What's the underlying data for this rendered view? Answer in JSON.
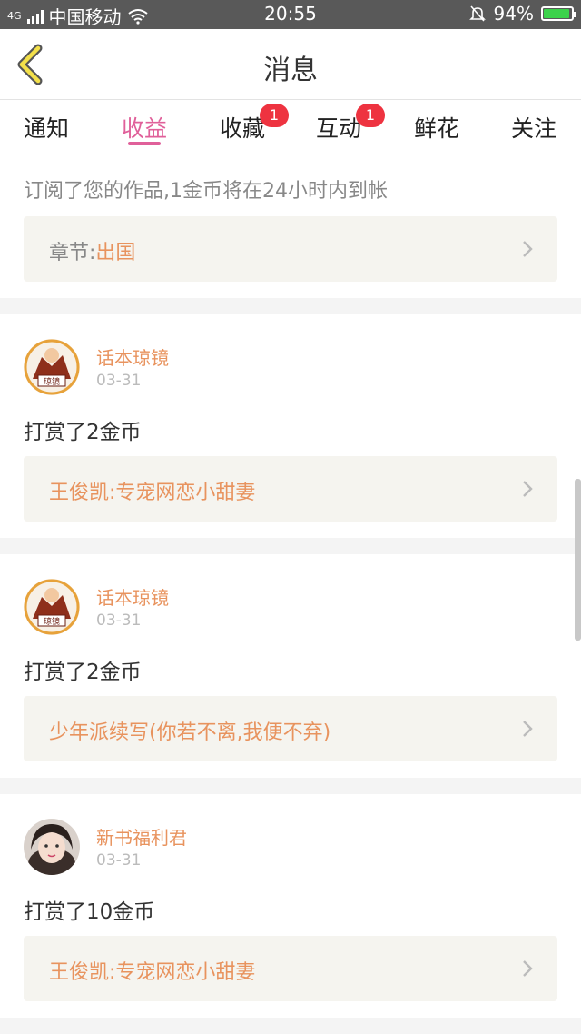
{
  "status_bar": {
    "network": "4G",
    "carrier": "中国移动",
    "time": "20:55",
    "battery": "94%",
    "battery_level": 0.94,
    "battery_color": "#3cd24b"
  },
  "header": {
    "title": "消息"
  },
  "tabs": [
    {
      "label": "通知",
      "badge": ""
    },
    {
      "label": "收益",
      "badge": "",
      "active": true
    },
    {
      "label": "收藏",
      "badge": "1"
    },
    {
      "label": "互动",
      "badge": "1"
    },
    {
      "label": "鲜花",
      "badge": ""
    },
    {
      "label": "关注",
      "badge": ""
    }
  ],
  "messages": {
    "partial": {
      "text": "订阅了您的作品,1金币将在24小时内到帐",
      "chapter_label": "章节:",
      "chapter_value": "出国"
    },
    "items": [
      {
        "user": "话本琼镜",
        "date": "03-31",
        "text": "打赏了2金币",
        "book": "王俊凯:专宠网恋小甜妻",
        "avatar": "avatar-comic"
      },
      {
        "user": "话本琼镜",
        "date": "03-31",
        "text": "打赏了2金币",
        "book": "少年派续写(你若不离,我便不弃)",
        "avatar": "avatar-comic"
      },
      {
        "user": "新书福利君",
        "date": "03-31",
        "text": "打赏了10金币",
        "book": "王俊凯:专宠网恋小甜妻",
        "avatar": "avatar-girl"
      }
    ]
  },
  "colors": {
    "accent": "#e0609a",
    "orange": "#e8935e",
    "badge": "#ee3340"
  }
}
